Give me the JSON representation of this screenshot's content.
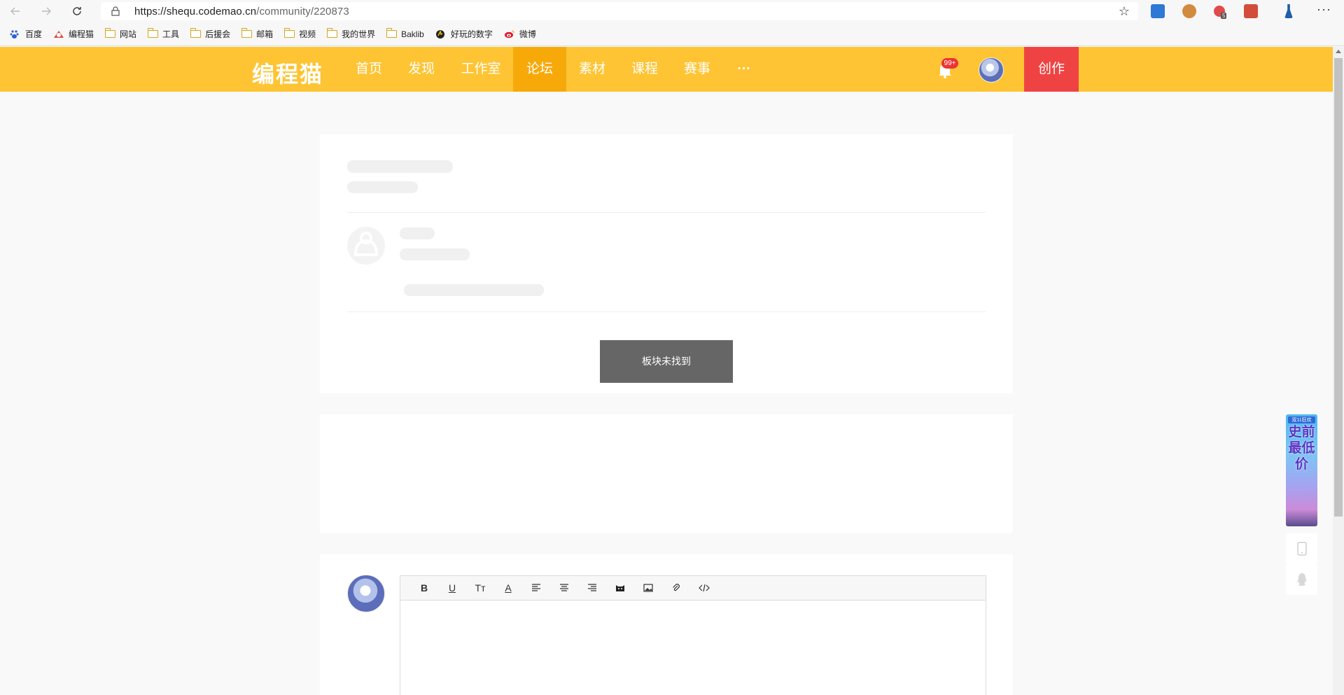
{
  "browser": {
    "url_host": "https://shequ.codemao.cn",
    "url_path": "/community/220873",
    "back_icon": "back-arrow-icon",
    "forward_icon": "forward-arrow-icon",
    "reload_icon": "reload-icon",
    "bookmarks": [
      {
        "label": "百度",
        "icon": "baidu-icon"
      },
      {
        "label": "编程猫",
        "icon": "codemao-icon"
      },
      {
        "label": "网站",
        "icon": "folder-icon"
      },
      {
        "label": "工具",
        "icon": "folder-icon"
      },
      {
        "label": "后援会",
        "icon": "folder-icon"
      },
      {
        "label": "邮箱",
        "icon": "folder-icon"
      },
      {
        "label": "视频",
        "icon": "folder-icon"
      },
      {
        "label": "我的世界",
        "icon": "folder-icon"
      },
      {
        "label": "Baklib",
        "icon": "folder-icon"
      },
      {
        "label": "好玩的数字",
        "icon": "number-icon"
      },
      {
        "label": "微博",
        "icon": "weibo-icon"
      }
    ],
    "extension_badge": "5"
  },
  "header": {
    "logo": "编程猫",
    "nav": [
      "首页",
      "发现",
      "工作室",
      "论坛",
      "素材",
      "课程",
      "赛事",
      "···"
    ],
    "active_nav": "论坛",
    "notification_count": "99+",
    "create_label": "创作",
    "accent_color": "#fec433",
    "active_color": "#f7a90a",
    "create_color": "#ef4343"
  },
  "main": {
    "toast_message": "板块未找到"
  },
  "editor": {
    "tools": [
      "B",
      "U",
      "Tт",
      "A",
      "align-left",
      "align-center",
      "align-right",
      "emoji",
      "image",
      "attach",
      "code"
    ]
  },
  "side": {
    "promo_top": "双11狂欢",
    "promo_text": "史前最低价",
    "phone_icon": "phone-icon",
    "qq_icon": "qq-icon"
  }
}
